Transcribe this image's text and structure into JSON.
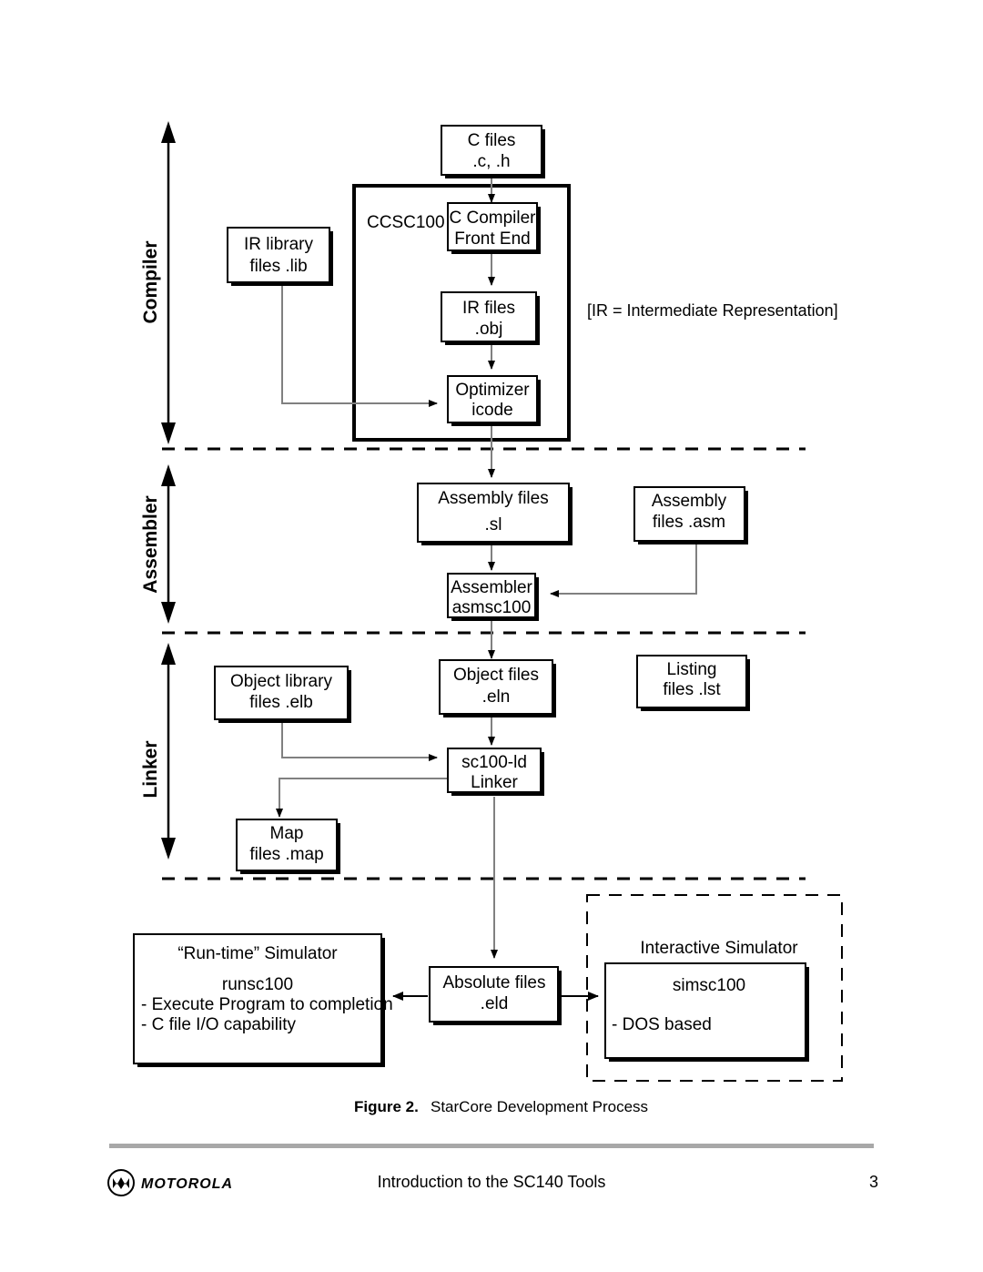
{
  "figure": {
    "caption_label": "Figure 2.",
    "caption_text": "StarCore Development Process",
    "note": "[IR = Intermediate Representation]"
  },
  "stages": [
    {
      "id": "compiler",
      "label": "Compiler"
    },
    {
      "id": "assembler",
      "label": "Assembler"
    },
    {
      "id": "linker",
      "label": "Linker"
    }
  ],
  "groups": {
    "ccsc100": {
      "label": "CCSC100"
    },
    "interactive_simulator": {
      "label": "Interactive Simulator"
    }
  },
  "nodes": {
    "c_files": {
      "line1": "C files",
      "line2": ".c, .h"
    },
    "ir_library": {
      "line1": "IR library",
      "line2": "files  .lib"
    },
    "c_compiler_front_end": {
      "line1": "C Compiler",
      "line2": "Front End"
    },
    "ir_files": {
      "line1": "IR files",
      "line2": ".obj"
    },
    "optimizer": {
      "line1": "Optimizer",
      "line2": "icode"
    },
    "assembly_files_sl": {
      "line1": "Assembly files",
      "line2": ".sl"
    },
    "assembly_files_asm": {
      "line1": "Assembly",
      "line2": "files .asm"
    },
    "assembler_tool": {
      "line1": "Assembler",
      "line2": "asmsc100"
    },
    "object_library": {
      "line1": "Object library",
      "line2": "files .elb"
    },
    "object_files": {
      "line1": "Object files",
      "line2": ".eln"
    },
    "listing_files": {
      "line1": "Listing",
      "line2": "files .lst"
    },
    "linker_tool": {
      "line1": "sc100-ld",
      "line2": "Linker"
    },
    "map_files": {
      "line1": "Map",
      "line2": "files .map"
    },
    "absolute_files": {
      "line1": "Absolute files",
      "line2": ".eld"
    },
    "runtime_simulator": {
      "title": "“Run-time” Simulator",
      "name": "runsc100",
      "bullet1": "- Execute Program to completion",
      "bullet2": "- C file I/O capability"
    },
    "interactive_simulator": {
      "name": "simsc100",
      "bullet1": "- DOS based"
    }
  },
  "footer": {
    "brand": "MOTOROLA",
    "title": "Introduction to the SC140 Tools",
    "page_number": "3"
  },
  "colors": {
    "ink": "#000000",
    "flow": "#808080",
    "rule": "#a8a8a8",
    "paper": "#ffffff"
  }
}
